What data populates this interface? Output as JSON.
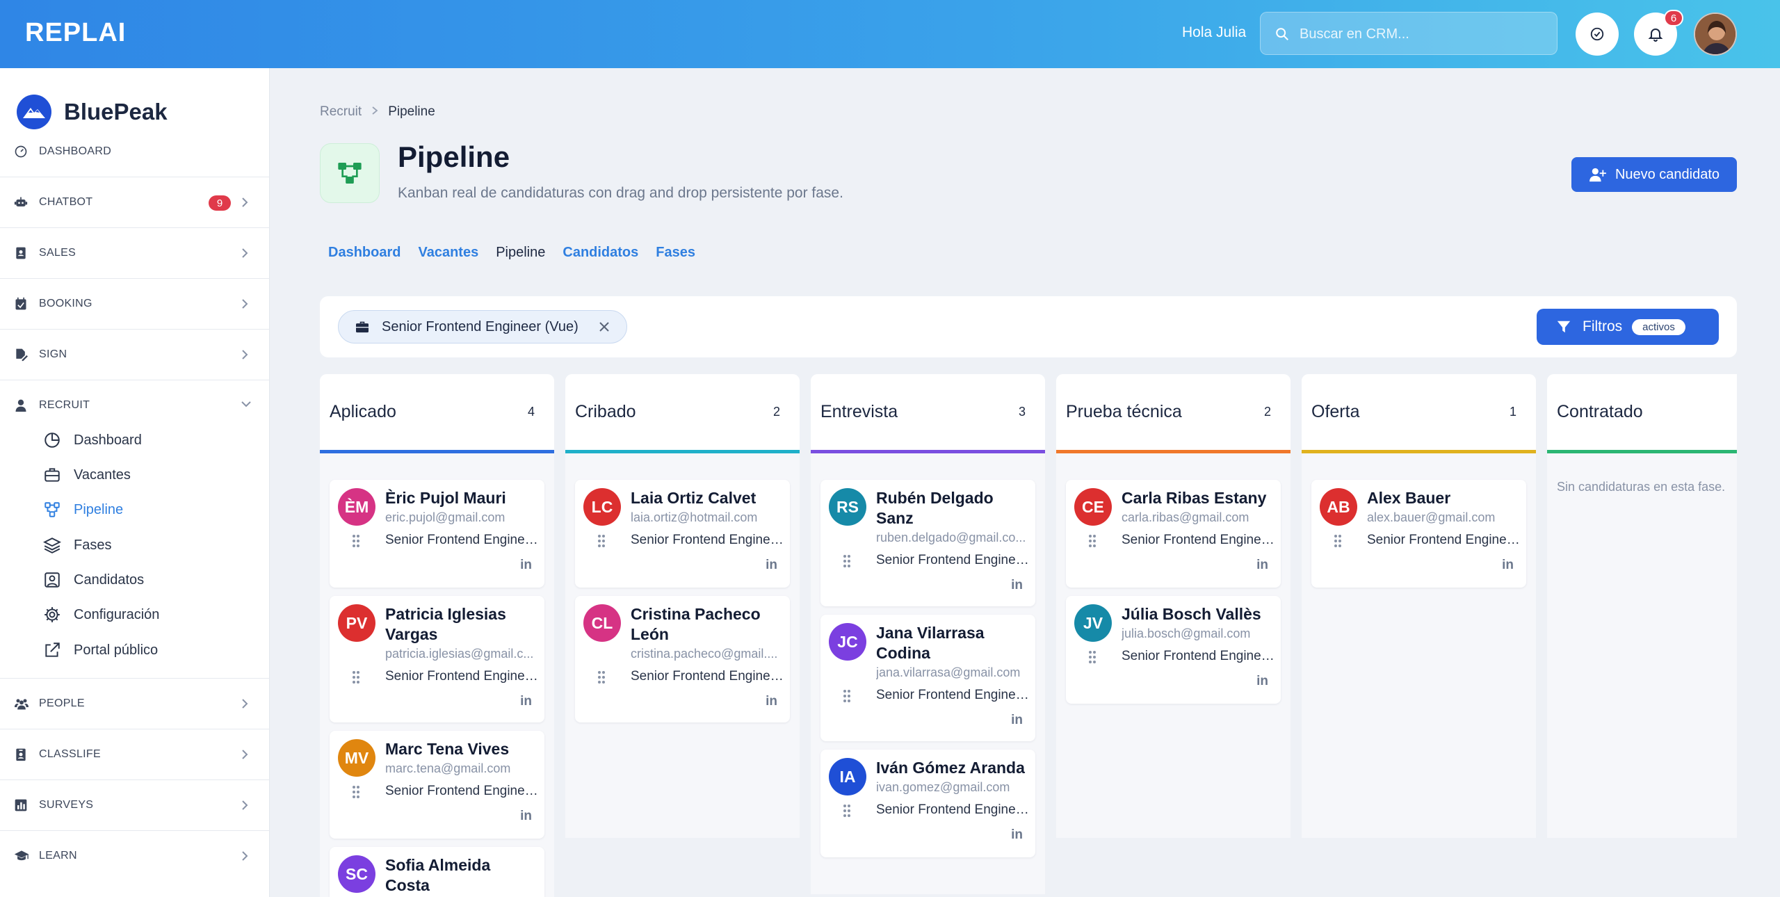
{
  "topbar": {
    "logo": "REPLAI",
    "greeting": "Hola Julia",
    "search_placeholder": "Buscar en CRM...",
    "notifications_count": "6"
  },
  "sidebar": {
    "brand": "BluePeak",
    "dashboard": "DASHBOARD",
    "sections": [
      {
        "label": "CHATBOT",
        "badge": "9"
      },
      {
        "label": "SALES"
      },
      {
        "label": "BOOKING"
      },
      {
        "label": "SIGN"
      },
      {
        "label": "RECRUIT"
      },
      {
        "label": "PEOPLE"
      },
      {
        "label": "CLASSLIFE"
      },
      {
        "label": "SURVEYS"
      },
      {
        "label": "LEARN"
      }
    ],
    "recruit_items": [
      "Dashboard",
      "Vacantes",
      "Pipeline",
      "Fases",
      "Candidatos",
      "Configuración",
      "Portal público"
    ]
  },
  "main": {
    "breadcrumb": [
      "Recruit",
      "Pipeline"
    ],
    "title": "Pipeline",
    "subtitle": "Kanban real de candidaturas con drag and drop persistente por fase.",
    "new_button": "Nuevo candidato",
    "tabs": [
      "Dashboard",
      "Vacantes",
      "Pipeline",
      "Candidatos",
      "Fases"
    ],
    "active_tab": "Pipeline",
    "filter_chip": "Senior Frontend Engineer (Vue)",
    "filter_button": "Filtros",
    "filter_pill": "activos"
  },
  "colors": {
    "applied": "#2f6fe0",
    "screened": "#1fb0c9",
    "interview": "#7a4fe0",
    "test": "#f0782b",
    "offer": "#e0b21e",
    "hired": "#2bb673"
  },
  "columns": [
    {
      "title": "Aplicado",
      "count": "4",
      "cards": [
        {
          "initials": "ÈM",
          "name": "Èric Pujol Mauri",
          "email": "eric.pujol@gmail.com",
          "job": "Senior Frontend Enginee...",
          "color": "#d63384"
        },
        {
          "initials": "PV",
          "name": "Patricia Iglesias Vargas",
          "email": "patricia.iglesias@gmail.c...",
          "job": "Senior Frontend Enginee...",
          "color": "#dc2f2f"
        },
        {
          "initials": "MV",
          "name": "Marc Tena Vives",
          "email": "marc.tena@gmail.com",
          "job": "Senior Frontend Enginee...",
          "color": "#e0860f"
        },
        {
          "initials": "SC",
          "name": "Sofia Almeida Costa",
          "email": "",
          "job": "",
          "color": "#7b3fe0"
        }
      ]
    },
    {
      "title": "Cribado",
      "count": "2",
      "cards": [
        {
          "initials": "LC",
          "name": "Laia Ortiz Calvet",
          "email": "laia.ortiz@hotmail.com",
          "job": "Senior Frontend Enginee...",
          "color": "#dc2f2f"
        },
        {
          "initials": "CL",
          "name": "Cristina Pacheco León",
          "email": "cristina.pacheco@gmail....",
          "job": "Senior Frontend Enginee...",
          "color": "#d63384"
        }
      ]
    },
    {
      "title": "Entrevista",
      "count": "3",
      "cards": [
        {
          "initials": "RS",
          "name": "Rubén Delgado Sanz",
          "email": "ruben.delgado@gmail.co...",
          "job": "Senior Frontend Enginee...",
          "color": "#168aa8"
        },
        {
          "initials": "JC",
          "name": "Jana Vilarrasa Codina",
          "email": "jana.vilarrasa@gmail.com",
          "job": "Senior Frontend Enginee...",
          "color": "#7b3fe0"
        },
        {
          "initials": "IA",
          "name": "Iván Gómez Aranda",
          "email": "ivan.gomez@gmail.com",
          "job": "Senior Frontend Enginee...",
          "color": "#1f4fd6"
        }
      ]
    },
    {
      "title": "Prueba técnica",
      "count": "2",
      "cards": [
        {
          "initials": "CE",
          "name": "Carla Ribas Estany",
          "email": "carla.ribas@gmail.com",
          "job": "Senior Frontend Enginee...",
          "color": "#dc2f2f"
        },
        {
          "initials": "JV",
          "name": "Júlia Bosch Vallès",
          "email": "julia.bosch@gmail.com",
          "job": "Senior Frontend Enginee...",
          "color": "#168aa8"
        }
      ]
    },
    {
      "title": "Oferta",
      "count": "1",
      "cards": [
        {
          "initials": "AB",
          "name": "Alex Bauer",
          "email": "alex.bauer@gmail.com",
          "job": "Senior Frontend Enginee...",
          "color": "#dc2f2f"
        }
      ]
    },
    {
      "title": "Contratado",
      "count": "",
      "empty": "Sin candidaturas en esta fase.",
      "cards": []
    }
  ],
  "linkedin_label": "in"
}
